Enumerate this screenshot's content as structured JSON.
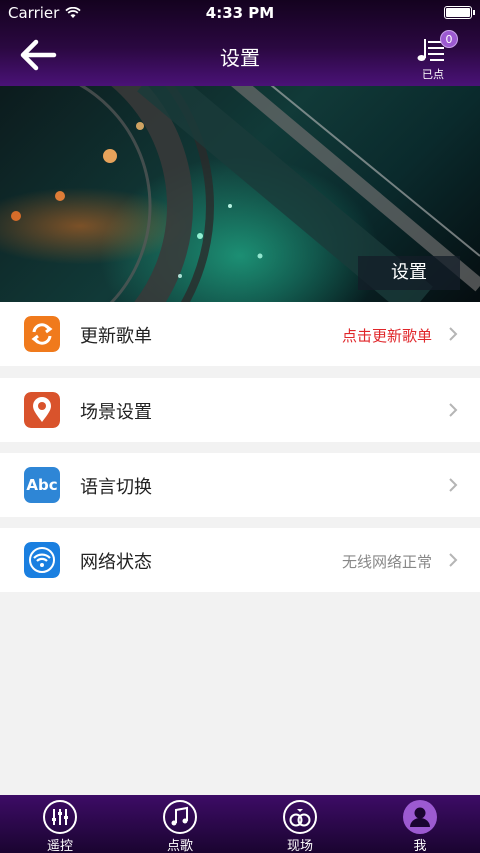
{
  "status_bar": {
    "carrier": "Carrier",
    "time": "4:33 PM"
  },
  "nav": {
    "title": "设置",
    "queue_count": "0",
    "queue_label": "已点"
  },
  "banner": {
    "caption": "设置"
  },
  "settings": [
    {
      "label": "更新歌单",
      "value": "点击更新歌单",
      "icon": "refresh-icon",
      "icon_color": "#f07a1c",
      "value_color": "#e0262a"
    },
    {
      "label": "场景设置",
      "value": "",
      "icon": "map-pin-icon",
      "icon_color": "#d9532c"
    },
    {
      "label": "语言切换",
      "value": "",
      "icon": "abc-icon",
      "icon_color": "#2e86d6",
      "icon_text": "Abc"
    },
    {
      "label": "网络状态",
      "value": "无线网络正常",
      "icon": "wifi-icon",
      "icon_color": "#1a7fe0"
    }
  ],
  "tabs": [
    {
      "label": "遥控",
      "icon": "remote-sliders-icon"
    },
    {
      "label": "点歌",
      "icon": "music-note-icon"
    },
    {
      "label": "现场",
      "icon": "rings-icon"
    },
    {
      "label": "我",
      "icon": "user-icon",
      "active": true
    }
  ],
  "colors": {
    "accent": "#4a1277",
    "tab_active": "#9c5ad1"
  }
}
